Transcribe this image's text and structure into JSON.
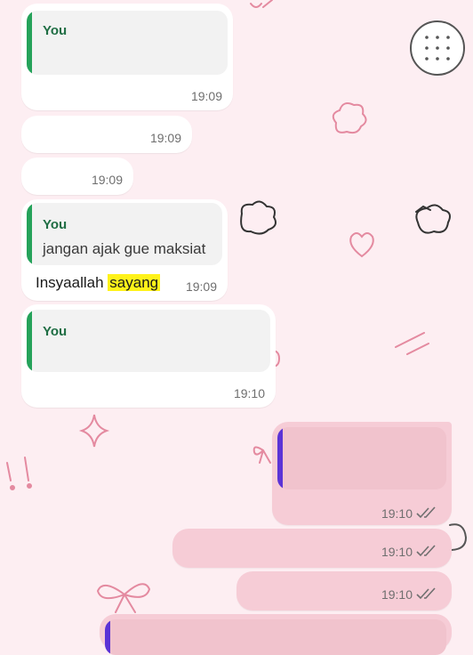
{
  "messages": [
    {
      "sender_label": "You",
      "quoted_text": "",
      "time": "19:09"
    },
    {
      "time": "19:09"
    },
    {
      "time": "19:09"
    },
    {
      "sender_label": "You",
      "quoted_text": "jangan ajak gue maksiat",
      "text_prefix": "Insyaallah ",
      "text_highlight": "sayang",
      "time": "19:09"
    },
    {
      "sender_label": "You",
      "quoted_text": "",
      "time": "19:10"
    },
    {
      "time": "19:10",
      "status": "read"
    },
    {
      "time": "19:10",
      "status": "read"
    },
    {
      "time": "19:10",
      "status": "read"
    }
  ],
  "colors": {
    "background": "#fdeef2",
    "incoming_bubble": "#ffffff",
    "outgoing_bubble": "#f6ccd6",
    "quote_bar_green": "#25a25a",
    "quote_bar_purple": "#5b33d6",
    "highlight": "#fff21a",
    "doodle": "#e48aa0"
  },
  "wallpaper_icons": [
    "cookie-icon",
    "heart-icon",
    "bow-icon",
    "sparkle-icon",
    "cloud-icon",
    "cup-icon"
  ]
}
